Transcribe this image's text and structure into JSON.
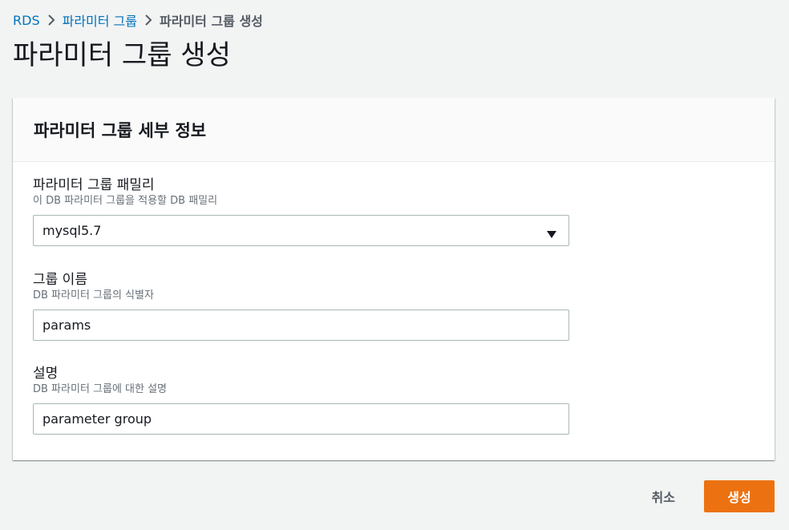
{
  "breadcrumb": {
    "items": [
      {
        "label": "RDS"
      },
      {
        "label": "파라미터 그룹"
      },
      {
        "label": "파라미터 그룹 생성"
      }
    ]
  },
  "page": {
    "title": "파라미터 그룹 생성"
  },
  "panel": {
    "title": "파라미터 그룹 세부 정보",
    "family": {
      "label": "파라미터 그룹 패밀리",
      "description": "이 DB 파라미터 그룹을 적용할 DB 패밀리",
      "value": "mysql5.7"
    },
    "group_name": {
      "label": "그룹 이름",
      "description": "DB 파라미터 그룹의 식별자",
      "value": "params"
    },
    "description_field": {
      "label": "설명",
      "description": "DB 파라미터 그룹에 대한 설명",
      "value": "parameter group"
    }
  },
  "actions": {
    "cancel_label": "취소",
    "create_label": "생성"
  },
  "colors": {
    "link": "#0073bb",
    "primary_button": "#ec7211",
    "background": "#f2f3f3"
  }
}
